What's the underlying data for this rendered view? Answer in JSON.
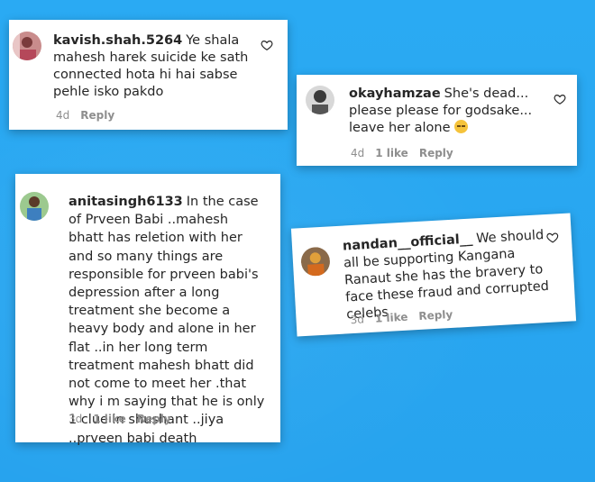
{
  "comments": [
    {
      "username": "kavish.shah.5264",
      "text": "Ye shala mahesh harek suicide ke sath connected hota hi hai sabse pehle isko pakdo",
      "time": "4d",
      "likes": "",
      "reply_label": "Reply"
    },
    {
      "username": "okayhamzae",
      "text": "She's dead... please please for godsake... leave her alone",
      "emoji": "unamused-face-emoji",
      "time": "4d",
      "likes": "1 like",
      "reply_label": "Reply"
    },
    {
      "username": "anitasingh6133",
      "text": "In the case of Prveen Babi ..mahesh bhatt has reletion with her and so many things are responsible for prveen babi's depression after a long treatment she become a heavy body and alone in her flat ..in her long term treatment mahesh bhatt did not come to meet her .that why i m saying that he is only 1 clue in shushant ..jiya ..prveen babi death",
      "time": "3d",
      "likes": "1 like",
      "reply_label": "Reply"
    },
    {
      "username": "nandan__official__",
      "text": "We should all be supporting Kangana Ranaut she has the bravery to face these fraud and corrupted celebs",
      "time": "3d",
      "likes": "1 like",
      "reply_label": "Reply"
    }
  ],
  "icons": {
    "like": "heart-outline-icon"
  },
  "colors": {
    "background": "#29a8f2",
    "card": "#ffffff",
    "text": "#262626",
    "meta": "#8e8e8e"
  }
}
